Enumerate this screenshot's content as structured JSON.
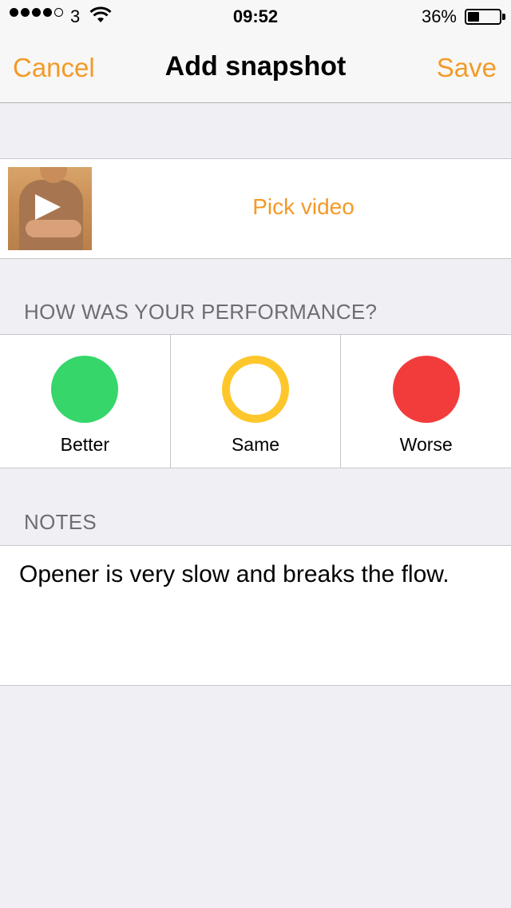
{
  "status_bar": {
    "carrier": "3",
    "time": "09:52",
    "battery_percent": "36%",
    "battery_level": 0.36,
    "signal_bars_filled": 4,
    "signal_bars_total": 5
  },
  "nav": {
    "cancel_label": "Cancel",
    "title": "Add snapshot",
    "save_label": "Save"
  },
  "video": {
    "pick_label": "Pick video",
    "thumbnail_icon": "play-icon"
  },
  "performance": {
    "header": "HOW WAS YOUR PERFORMANCE?",
    "options": [
      {
        "label": "Better",
        "color": "#37d66a",
        "style": "filled"
      },
      {
        "label": "Same",
        "color": "#fdc72c",
        "style": "ring",
        "selected": true
      },
      {
        "label": "Worse",
        "color": "#f23c3c",
        "style": "filled"
      }
    ]
  },
  "notes": {
    "header": "NOTES",
    "text": "Opener is very slow and breaks the flow."
  },
  "colors": {
    "accent": "#f39a27",
    "background": "#efeff4"
  }
}
